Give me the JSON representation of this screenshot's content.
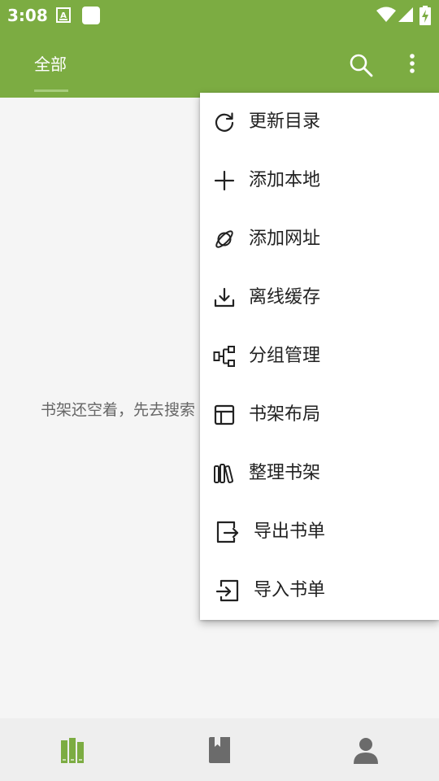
{
  "status_bar": {
    "time": "3:08",
    "icons": [
      "a-keyboard-icon",
      "white-square-icon",
      "wifi-icon",
      "signal-icon",
      "battery-charging-icon"
    ]
  },
  "app_bar": {
    "tab_label": "全部",
    "actions": [
      "search-icon",
      "more-vert-icon"
    ]
  },
  "main": {
    "empty_message": "书架还空着，先去搜索"
  },
  "menu": {
    "items": [
      {
        "label": "更新目录",
        "icon": "refresh-icon"
      },
      {
        "label": "添加本地",
        "icon": "plus-icon"
      },
      {
        "label": "添加网址",
        "icon": "planet-icon"
      },
      {
        "label": "离线缓存",
        "icon": "download-icon"
      },
      {
        "label": "分组管理",
        "icon": "group-icon"
      },
      {
        "label": "书架布局",
        "icon": "layout-icon"
      },
      {
        "label": "整理书架",
        "icon": "books-icon"
      },
      {
        "label": "导出书单",
        "icon": "export-icon"
      },
      {
        "label": "导入书单",
        "icon": "import-icon"
      }
    ]
  },
  "bottom_nav": {
    "items": [
      {
        "icon": "bookshelf-icon",
        "active": true
      },
      {
        "icon": "book-icon",
        "active": false
      },
      {
        "icon": "person-icon",
        "active": false
      }
    ],
    "active_color": "#7cac42",
    "inactive_color": "#6b6b6b"
  },
  "colors": {
    "primary": "#7cac42",
    "background": "#f5f5f5"
  }
}
